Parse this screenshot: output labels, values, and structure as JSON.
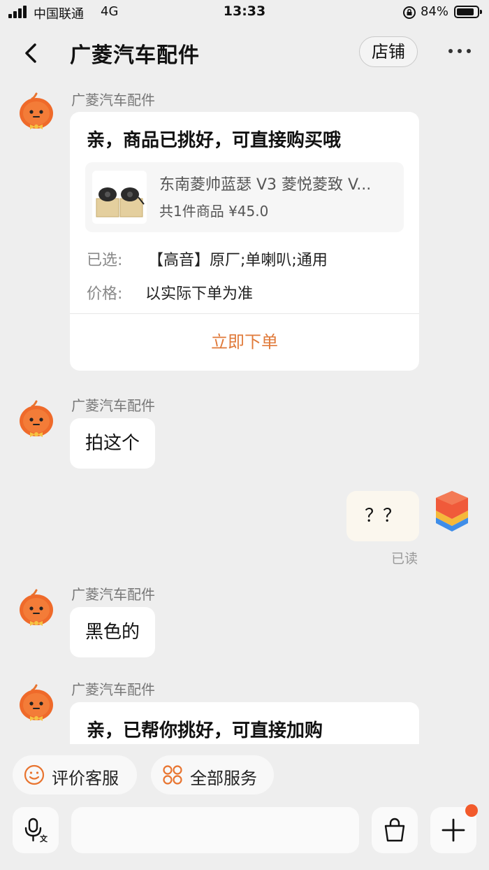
{
  "status_bar": {
    "carrier": "中国联通",
    "network": "4G",
    "time": "13:33",
    "battery_percent": "84%",
    "battery_level": 0.84
  },
  "header": {
    "title": "广菱汽车配件",
    "shop_button": "店铺"
  },
  "chat": {
    "messages": [
      {
        "sender": "广菱汽车配件",
        "card": {
          "title": "亲，商品已挑好，可直接购买哦",
          "product_name": "东南菱帅蓝瑟 V3 菱悦菱致 V...",
          "product_meta": "共1件商品 ¥45.0",
          "selected_label": "已选:",
          "selected_value": "【高音】原厂;单喇叭;通用",
          "price_label": "价格:",
          "price_value": "以实际下单为准",
          "action": "立即下单"
        }
      },
      {
        "sender": "广菱汽车配件",
        "text": "拍这个"
      },
      {
        "text": "？？",
        "status": "已读"
      },
      {
        "sender": "广菱汽车配件",
        "text": "黑色的"
      },
      {
        "sender": "广菱汽车配件",
        "card_title": "亲，已帮你挑好，可直接加购"
      }
    ]
  },
  "quick_actions": [
    {
      "label": "评价客服",
      "icon": "smile-rating-icon"
    },
    {
      "label": "全部服务",
      "icon": "services-grid-icon"
    }
  ],
  "input_bar": {
    "placeholder": "",
    "voice_icon": "voice-input-icon",
    "emoji_icon": "smile-icon",
    "cart_icon": "shopping-bag-icon",
    "plus_icon": "plus-icon"
  },
  "colors": {
    "accent": "#e07a3a",
    "badge": "#f25a2b",
    "my_bubble": "#fbf7ee",
    "background": "#eeeeee"
  }
}
